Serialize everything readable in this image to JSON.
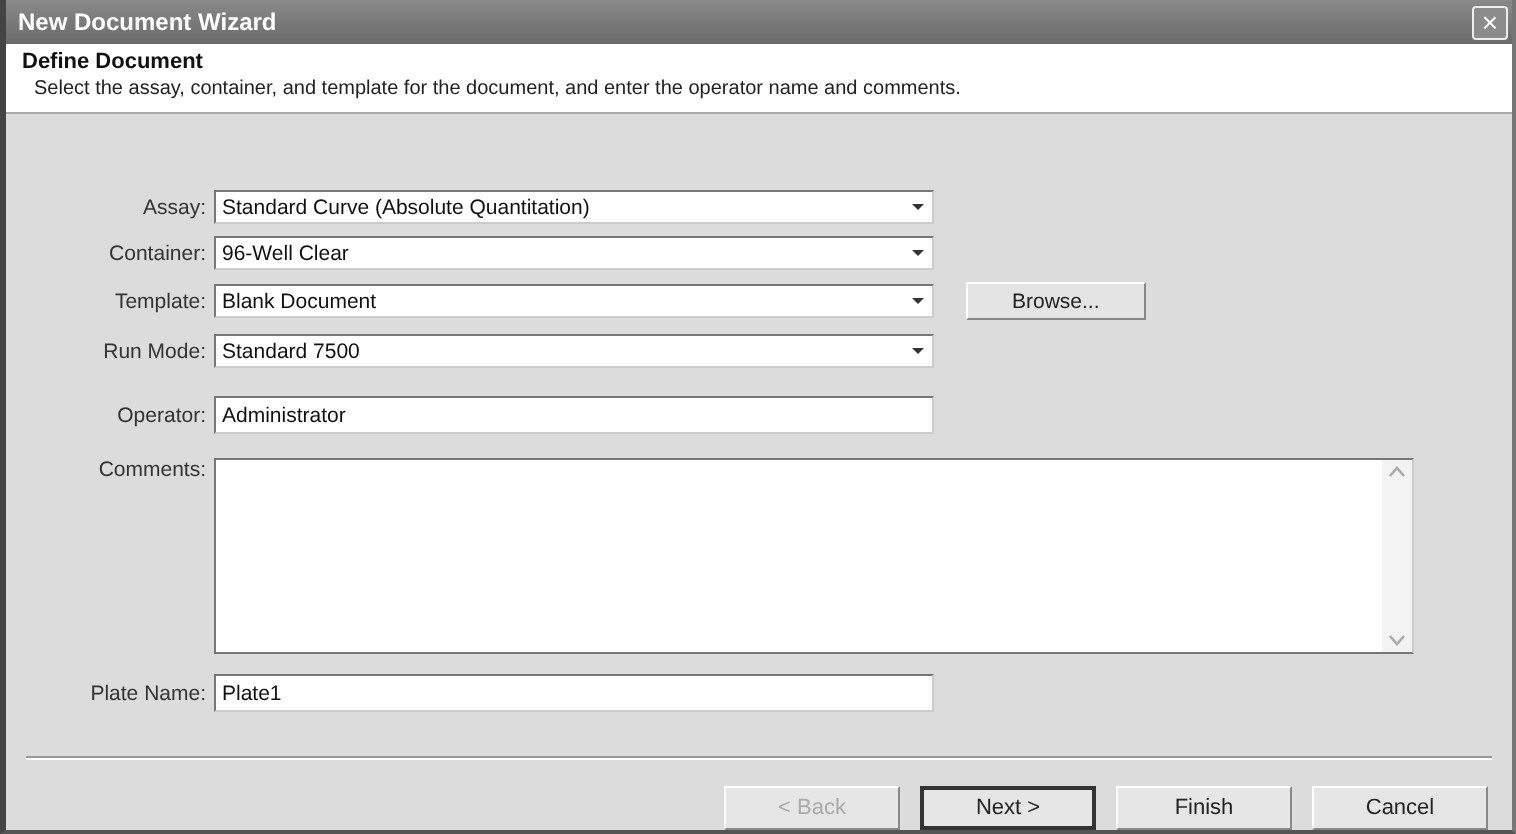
{
  "window": {
    "title": "New Document Wizard",
    "close": "×"
  },
  "header": {
    "title": "Define Document",
    "description": "Select the assay, container, and template for the document, and enter the operator name and comments."
  },
  "fields": [
    {
      "label": "Assay:",
      "value": "Standard Curve (Absolute Quantitation)",
      "kind": "dropdown"
    },
    {
      "label": "Container:",
      "value": "96-Well Clear",
      "kind": "dropdown"
    },
    {
      "label": "Template:",
      "value": "Blank Document",
      "kind": "dropdown",
      "button": "Browse..."
    },
    {
      "label": "Run Mode:",
      "value": "Standard 7500",
      "kind": "dropdown"
    },
    {
      "label": "Operator:",
      "value": "Administrator",
      "kind": "text"
    }
  ],
  "comments": {
    "label": "Comments:"
  },
  "plate_name": {
    "label": "Plate Name:",
    "value": "Plate1"
  },
  "buttons": [
    {
      "label": "< Back",
      "disabled": true,
      "default": false
    },
    {
      "label": "Next >",
      "disabled": false,
      "default": true
    },
    {
      "label": "Finish",
      "disabled": false,
      "default": false
    },
    {
      "label": "Cancel",
      "disabled": false,
      "default": false
    }
  ]
}
